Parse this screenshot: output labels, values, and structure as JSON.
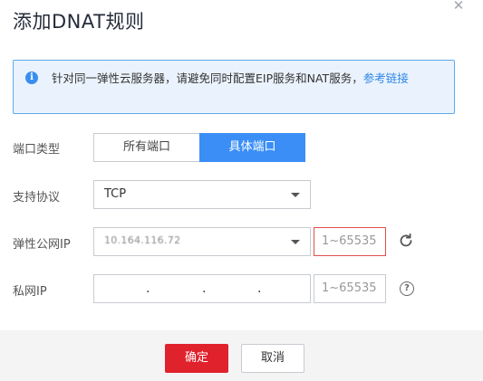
{
  "dialog": {
    "title": "添加DNAT规则",
    "close_icon": "close-icon"
  },
  "notice": {
    "icon": "info-icon",
    "text": "针对同一弹性云服务器，请避免同时配置EIP服务和NAT服务，",
    "link": "参考链接"
  },
  "form": {
    "port_type": {
      "label": "端口类型",
      "options": [
        "所有端口",
        "具体端口"
      ],
      "selected": "具体端口"
    },
    "protocol": {
      "label": "支持协议",
      "value": "TCP"
    },
    "eip": {
      "label": "弹性公网IP",
      "value": "10.164.116.72",
      "port_placeholder": "1~65535",
      "refresh_icon": "refresh-icon"
    },
    "private_ip": {
      "label": "私网IP",
      "octets": [
        "",
        "",
        "",
        ""
      ],
      "separator": ".",
      "port_placeholder": "1~65535",
      "help_icon": "help-icon"
    }
  },
  "footer": {
    "confirm_label": "确定",
    "cancel_label": "取消"
  },
  "colors": {
    "primary_blue": "#3a8ef6",
    "confirm_red": "#e0222d",
    "error_border": "#e2504b",
    "notice_bg": "#eaf3fd"
  }
}
